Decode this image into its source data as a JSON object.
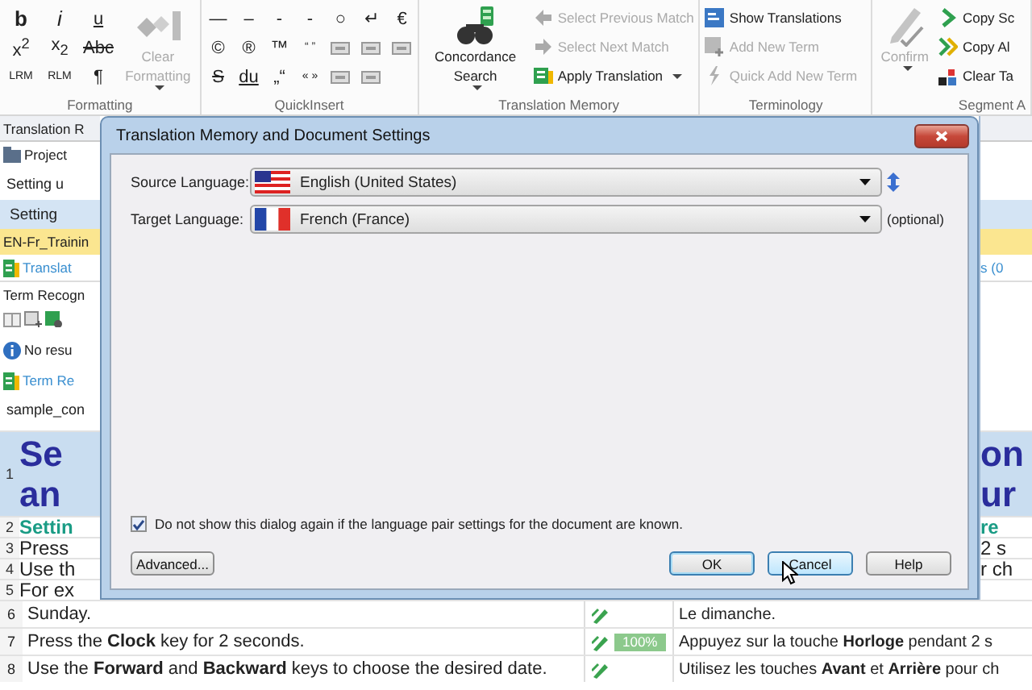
{
  "ribbon": {
    "groups": [
      {
        "label": "Formatting",
        "items": [
          {
            "kind": "bold",
            "label": "b",
            "disabled": false
          },
          {
            "kind": "italic",
            "label": "i",
            "disabled": false
          },
          {
            "kind": "under",
            "label": "u",
            "disabled": false
          },
          {
            "kind": "glyph",
            "label": "x$^{2}$",
            "disabled": false
          },
          {
            "kind": "glyph",
            "label": "x$_{2}$",
            "disabled": false
          },
          {
            "kind": "strike",
            "label": "Abc",
            "disabled": false
          },
          {
            "kind": "glyph",
            "label": "LRM",
            "disabled": false
          },
          {
            "kind": "glyph",
            "label": "RLM",
            "disabled": false
          },
          {
            "kind": "glyph",
            "label": "¶",
            "disabled": false
          },
          {
            "kind": "large",
            "label": "Clear Formatting",
            "disabled": true,
            "dropdown": true
          }
        ]
      },
      {
        "label": "QuickInsert",
        "items": [
          {
            "kind": "glyph",
            "label": "—",
            "disabled": false
          },
          {
            "kind": "glyph",
            "label": "–",
            "disabled": false
          },
          {
            "kind": "glyph",
            "label": "-",
            "disabled": false
          },
          {
            "kind": "glyph",
            "label": "-",
            "disabled": false
          },
          {
            "kind": "glyph",
            "label": "○",
            "disabled": false
          },
          {
            "kind": "glyph",
            "label": "↵",
            "disabled": false
          },
          {
            "kind": "glyph",
            "label": "€",
            "disabled": false
          },
          {
            "kind": "glyph",
            "label": "©",
            "disabled": false
          },
          {
            "kind": "glyph",
            "label": "®",
            "disabled": false
          },
          {
            "kind": "glyph",
            "label": "™",
            "disabled": false
          },
          {
            "kind": "glyph",
            "label": "“ ”",
            "disabled": false
          },
          {
            "kind": "tag",
            "disabled": false
          },
          {
            "kind": "tag",
            "disabled": false
          },
          {
            "kind": "tag",
            "disabled": false
          },
          {
            "kind": "strike",
            "label": "S",
            "disabled": false
          },
          {
            "kind": "under",
            "label": "du",
            "disabled": false
          },
          {
            "kind": "glyph",
            "label": "„“",
            "disabled": false
          },
          {
            "kind": "glyph",
            "label": "« »",
            "disabled": false
          },
          {
            "kind": "tag",
            "disabled": false
          },
          {
            "kind": "tag",
            "disabled": false
          }
        ]
      },
      {
        "label": "Translation Memory",
        "items": [
          {
            "kind": "large",
            "label": "Concordance Search",
            "disabled": false,
            "dropdown": true
          },
          {
            "kind": "small",
            "label": "Select Previous Match",
            "disabled": true,
            "dropdown": false
          },
          {
            "kind": "small",
            "label": "Select Next Match",
            "disabled": true,
            "dropdown": false
          },
          {
            "kind": "small",
            "label": "Apply Translation",
            "disabled": false,
            "dropdown": true
          }
        ]
      },
      {
        "label": "Terminology",
        "items": [
          {
            "kind": "small",
            "label": "Show Translations",
            "disabled": false,
            "dropdown": false
          },
          {
            "kind": "small",
            "label": "Add New Term",
            "disabled": true,
            "dropdown": false
          },
          {
            "kind": "small",
            "label": "Quick Add New Term",
            "disabled": true,
            "dropdown": false
          }
        ]
      },
      {
        "label": "Segment A",
        "items": [
          {
            "kind": "large",
            "label": "Confirm",
            "disabled": true,
            "dropdown": true
          },
          {
            "kind": "small",
            "label": "Copy Sc",
            "disabled": false,
            "dropdown": false
          },
          {
            "kind": "small",
            "label": "Copy Al",
            "disabled": false,
            "dropdown": false
          },
          {
            "kind": "small",
            "label": "Clear Ta",
            "disabled": false,
            "dropdown": false
          }
        ]
      }
    ]
  },
  "side_rows": [
    {
      "kind": "tab",
      "left": "Translation R"
    },
    {
      "kind": "item",
      "left": "Project"
    },
    {
      "kind": "text",
      "left": "Setting u"
    },
    {
      "kind": "header",
      "left": "Setting"
    },
    {
      "kind": "highlight",
      "left": "EN-Fr_Trainin"
    },
    {
      "kind": "link",
      "left": "Translat",
      "right": "s (0"
    },
    {
      "kind": "label",
      "left": "Term Recogn"
    },
    {
      "kind": "toolbar"
    },
    {
      "kind": "info",
      "left": "No resu"
    },
    {
      "kind": "link",
      "left": "Term Re"
    },
    {
      "kind": "text",
      "left": "sample_con"
    }
  ],
  "editor": {
    "rows": [
      {
        "number": "1",
        "kind": "heading",
        "under_dialog": true,
        "source": [
          "Se",
          "an"
        ],
        "target": [
          "on",
          "ur"
        ]
      },
      {
        "number": "2",
        "kind": "subheading",
        "under_dialog": true,
        "source": [
          "Settin"
        ],
        "target": [
          "re"
        ]
      },
      {
        "number": "3",
        "kind": "body",
        "under_dialog": true,
        "source": [
          "Press"
        ],
        "target": [
          "2 s"
        ]
      },
      {
        "number": "4",
        "kind": "body",
        "under_dialog": true,
        "source": [
          "Use th"
        ],
        "target": [
          "r ch"
        ]
      },
      {
        "number": "5",
        "kind": "body",
        "under_dialog": true,
        "source": [
          "For ex"
        ]
      },
      {
        "number": "6",
        "kind": "body",
        "under_dialog": false,
        "source": [
          "Sunday."
        ],
        "target": [
          "Le dimanche."
        ]
      },
      {
        "number": "7",
        "kind": "body",
        "under_dialog": false,
        "source": [
          "Press the **Clock** key for 2 seconds."
        ],
        "match": "100%",
        "target": [
          "Appuyez sur la touche **Horloge** pendant 2 s"
        ]
      },
      {
        "number": "8",
        "kind": "body",
        "under_dialog": false,
        "source": [
          "Use the **Forward** and **Backward** keys to choose the desired date."
        ],
        "target": [
          "Utilisez les touches **Avant** et **Arrière** pour ch"
        ]
      }
    ]
  },
  "dialog": {
    "title": "Translation Memory and Document Settings",
    "fields": [
      {
        "label": "Source Language:",
        "value": "English (United States)"
      },
      {
        "label": "Target Language:",
        "value": "French (France)",
        "note": "(optional)"
      }
    ],
    "checkbox": {
      "label": "Do not show this dialog again if the language pair settings for the document are known.",
      "checked": true
    },
    "buttons": [
      {
        "label": "Advanced...",
        "focused": false,
        "hovered": false
      },
      {
        "label": "OK",
        "focused": true,
        "hovered": false
      },
      {
        "label": "Cancel",
        "focused": false,
        "hovered": true
      },
      {
        "label": "Help",
        "focused": false,
        "hovered": false
      }
    ]
  }
}
